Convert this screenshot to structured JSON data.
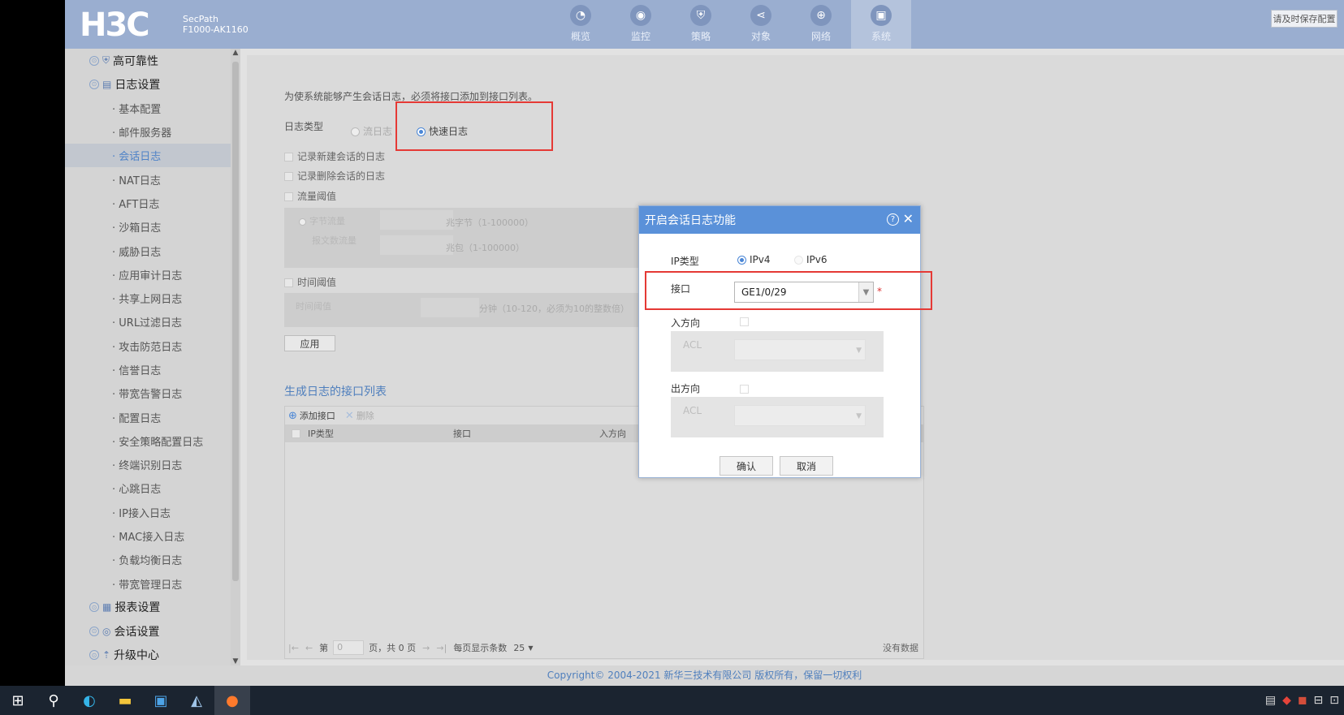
{
  "header": {
    "logo": "H3C",
    "product_line1": "SecPath",
    "product_line2": "F1000-AK1160",
    "nav": [
      {
        "label": "概览",
        "icon": "dashboard-icon",
        "glyph": "◔"
      },
      {
        "label": "监控",
        "icon": "monitor-icon",
        "glyph": "◉"
      },
      {
        "label": "策略",
        "icon": "shield-icon",
        "glyph": "⛨"
      },
      {
        "label": "对象",
        "icon": "share-icon",
        "glyph": "⋖"
      },
      {
        "label": "网络",
        "icon": "globe-icon",
        "glyph": "⊕"
      },
      {
        "label": "系统",
        "icon": "system-icon",
        "glyph": "▣",
        "active": true
      }
    ],
    "save_config": "请及时保存配置"
  },
  "sidebar": {
    "groups_top": [
      {
        "label": "高可靠性",
        "icon": "shield-icon"
      },
      {
        "label": "日志设置",
        "icon": "log-icon"
      }
    ],
    "items": [
      "基本配置",
      "邮件服务器",
      "会话日志",
      "NAT日志",
      "AFT日志",
      "沙箱日志",
      "威胁日志",
      "应用审计日志",
      "共享上网日志",
      "URL过滤日志",
      "攻击防范日志",
      "信誉日志",
      "带宽告警日志",
      "配置日志",
      "安全策略配置日志",
      "终端识别日志",
      "心跳日志",
      "IP接入日志",
      "MAC接入日志",
      "负载均衡日志",
      "带宽管理日志"
    ],
    "active_item": "会话日志",
    "groups_bottom": [
      {
        "label": "报表设置",
        "icon": "report-icon"
      },
      {
        "label": "会话设置",
        "icon": "chat-icon"
      },
      {
        "label": "升级中心",
        "icon": "upload-icon"
      }
    ]
  },
  "content": {
    "hint": "为使系统能够产生会话日志，必须将接口添加到接口列表。",
    "log_type_label": "日志类型",
    "log_type_options": [
      "流日志",
      "快速日志"
    ],
    "log_type_selected": "快速日志",
    "chk_new": "记录新建会话的日志",
    "chk_delete": "记录删除会话的日志",
    "chk_traffic": "流量阈值",
    "traffic_bytes": "字节流量",
    "traffic_packets": "报文数流量",
    "unit_bytes": "兆字节（1-100000）",
    "unit_packets": "兆包（1-100000）",
    "chk_time": "时间阈值",
    "time_label": "时间阈值",
    "time_unit": "分钟（10-120，必须为10的整数倍）",
    "apply": "应用",
    "list_title": "生成日志的接口列表",
    "add_iface": "添加接口",
    "delete": "删除",
    "columns": [
      "IP类型",
      "接口",
      "入方向"
    ],
    "pager_page": "第",
    "pager_value": "0",
    "pager_total": "页，共 0 页",
    "pager_per": "每页显示条数",
    "pager_size": "25",
    "no_data": "没有数据"
  },
  "dialog": {
    "title": "开启会话日志功能",
    "ip_type_label": "IP类型",
    "ip_options": [
      "IPv4",
      "IPv6"
    ],
    "ip_selected": "IPv4",
    "iface_label": "接口",
    "iface_value": "GE1/0/29",
    "required": "*",
    "in_label": "入方向",
    "out_label": "出方向",
    "acl": "ACL",
    "confirm": "确认",
    "cancel": "取消"
  },
  "footer": {
    "copyright": "Copyright© 2004-2021 新华三技术有限公司 版权所有，保留一切权利"
  }
}
